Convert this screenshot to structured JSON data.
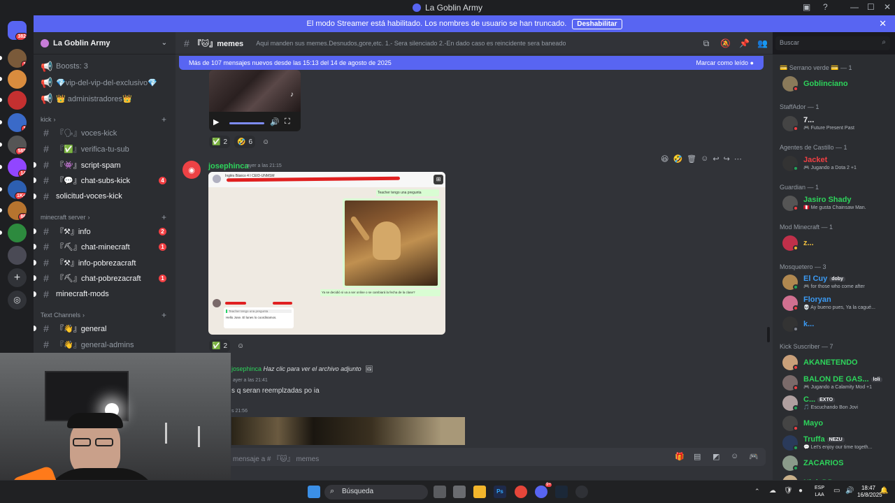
{
  "window": {
    "title": "La Goblin Army"
  },
  "servers": [
    {
      "name": "discord-home",
      "badge": "382",
      "color": "#5865f2"
    },
    {
      "name": "server-1",
      "badge": "1",
      "color": "#7a5a3a"
    },
    {
      "name": "server-2",
      "badge": "",
      "color": "#d98c3e"
    },
    {
      "name": "server-3",
      "badge": "",
      "color": "#c43030"
    },
    {
      "name": "server-4",
      "badge": "1",
      "color": "#3a6ac8"
    },
    {
      "name": "server-5",
      "badge": "585",
      "color": "#555"
    },
    {
      "name": "server-twitch",
      "badge": "14",
      "color": "#9146ff"
    },
    {
      "name": "server-7",
      "badge": "1K+",
      "color": "#2d5fb0"
    },
    {
      "name": "server-8",
      "badge": "86",
      "color": "#b6742f"
    },
    {
      "name": "server-9",
      "badge": "",
      "color": "#2d8a3e"
    },
    {
      "name": "server-10",
      "badge": "",
      "color": "#4a4a55"
    }
  ],
  "banner": {
    "text": "El modo Streamer está habilitado. Los nombres de usuario se han truncado.",
    "button": "Deshabilitar"
  },
  "guild": {
    "name": "La Goblin Army"
  },
  "channels": {
    "top": [
      {
        "label": "Boosts: 3"
      },
      {
        "label": "💎vip-del-vip-del-exclusivo💎"
      },
      {
        "label": "👑 administradores👑"
      }
    ],
    "cat_kick": "kick",
    "kick": [
      {
        "label": "『🗣』voces-kick",
        "badge": ""
      },
      {
        "label": "『✅』verifica-tu-sub",
        "badge": ""
      },
      {
        "label": "『👾』script-spam",
        "badge": ""
      },
      {
        "label": "『💬』chat-subs-kick",
        "badge": "4"
      },
      {
        "label": "solicitud-voces-kick",
        "badge": ""
      }
    ],
    "cat_mc": "minecraft server",
    "mc": [
      {
        "label": "『⚒』info",
        "badge": "2"
      },
      {
        "label": "『⛏』chat-minecraft",
        "badge": "1"
      },
      {
        "label": "『⚒』info-pobrezacraft",
        "badge": ""
      },
      {
        "label": "『⛏』chat-pobrezacraft",
        "badge": "1"
      },
      {
        "label": "minecraft-mods",
        "badge": ""
      }
    ],
    "cat_text": "Text Channels",
    "text": [
      {
        "label": "『👋』general",
        "badge": ""
      },
      {
        "label": "『👋』general-admins",
        "badge": ""
      }
    ]
  },
  "chat": {
    "channel": "『🐱』memes",
    "topic": "Aqui manden sus memes.Desnudos,gore,etc. 1.- Sera silenciado 2.-En dado caso es reincidente sera baneado",
    "search_placeholder": "Buscar",
    "new_messages": "Más de 107 mensajes nuevos desde las 15:13 del 14 de agosto de 2025",
    "mark_read": "Marcar como leído",
    "composer_placeholder": "mensaje a # 『🐱』 memes"
  },
  "messages": [
    {
      "reactions": [
        {
          "emoji": "✅",
          "count": "2"
        },
        {
          "emoji": "🤣",
          "count": "6"
        }
      ]
    },
    {
      "author": "josephinca",
      "time": "ayer a las 21:15",
      "reactions": [
        {
          "emoji": "✅",
          "count": "2"
        }
      ],
      "attachment": {
        "group": "Inglés Básico 4 I CEID-UNMSM",
        "bubble1": "Teacher tengo una pregunta",
        "bubble2": "Ya se decidió si va a ser online o se cambiará la fecha de la clase?",
        "reply": "Teacher tengo una pregunta",
        "reply2": "Hello Jose. El lunes lo coordinamos."
      }
    },
    {
      "author": "josephinca",
      "reply_text": "Haz clic para ver el archivo adjunto",
      "time": "ayer a las 21:41",
      "text": "s q seran reemplzadas po ia"
    },
    {
      "time": "s 21:56"
    }
  ],
  "members": {
    "roles": [
      {
        "label": "💳 Serrano verde 💳 — 1"
      },
      {
        "label": "StaffAdor — 1"
      },
      {
        "label": "Agentes de Castillo — 1"
      },
      {
        "label": "Guardian — 1"
      },
      {
        "label": "Mod Minecraft — 1"
      },
      {
        "label": "Mosquetero — 3"
      },
      {
        "label": "Kick Suscriber — 7"
      }
    ],
    "list": [
      {
        "name": "Goblinciano",
        "sub": "",
        "color": "#2dd45b",
        "tag": ""
      },
      {
        "name": "7...",
        "sub": "🎮 Future Present Past",
        "color": "#f2f3f5",
        "tag": ""
      },
      {
        "name": "Jacket",
        "sub": "🎮 Jugando a Dota 2 +1",
        "color": "#f23f43",
        "tag": ""
      },
      {
        "name": "Jasiro Shady",
        "sub": "🇵🇪 Me gusta Chainsaw Man.",
        "color": "#2dd45b",
        "tag": ""
      },
      {
        "name": "z...",
        "sub": "",
        "color": "#f0c040",
        "tag": ""
      },
      {
        "name": "El Cuy",
        "sub": "🎮 for those who come after",
        "color": "#3b9bf5",
        "tag": "doby"
      },
      {
        "name": "Floryan",
        "sub": "💀 Ay bueno pues, Ya la cagué...",
        "color": "#3b9bf5",
        "tag": ""
      },
      {
        "name": "k...",
        "sub": "",
        "color": "#3b9bf5",
        "tag": ""
      },
      {
        "name": "AKANETENDO",
        "sub": "",
        "color": "#2dd45b",
        "tag": ""
      },
      {
        "name": "BALON DE GAS...",
        "sub": "🎮 Jugando a Calamity Mod +1",
        "color": "#2dd45b",
        "tag": "loli"
      },
      {
        "name": "C...",
        "sub": "🎵 Escuchando Bon Jovi",
        "color": "#2dd45b",
        "tag": "EXTO"
      },
      {
        "name": "Mayo",
        "sub": "",
        "color": "#2dd45b",
        "tag": ""
      },
      {
        "name": "Truffa",
        "sub": "💬 Let's enjoy our time togeth...",
        "color": "#2dd45b",
        "tag": "NEZU"
      },
      {
        "name": "ZACARIOS",
        "sub": "",
        "color": "#2dd45b",
        "tag": ""
      },
      {
        "name": "NinjaDD",
        "sub": "",
        "color": "#2dd45b",
        "tag": "PEAK"
      }
    ]
  },
  "taskbar": {
    "search": "Búsqueda",
    "lang": "ESP",
    "lang2": "LAA",
    "time": "18:47",
    "date": "16/8/2025",
    "discord_badge": "9+"
  }
}
